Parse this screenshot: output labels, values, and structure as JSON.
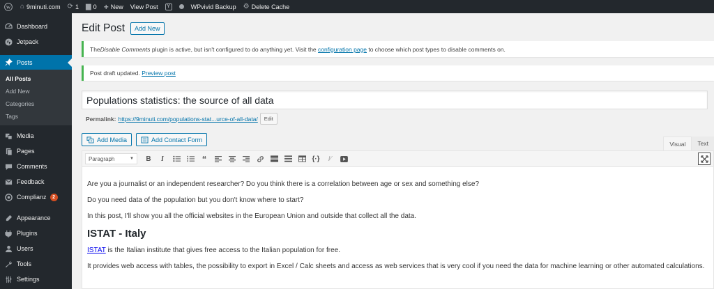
{
  "adminbar": {
    "site_name": "9minuti.com",
    "updates_count": "1",
    "comments_count": "0",
    "new_label": "New",
    "view_post_label": "View Post",
    "wpvivid_label": "WPvivid Backup",
    "delete_cache_label": "Delete Cache"
  },
  "sidebar": {
    "items": [
      {
        "label": "Dashboard",
        "icon": "dashboard-icon"
      },
      {
        "label": "Jetpack",
        "icon": "jetpack-icon"
      },
      {
        "label": "Posts",
        "icon": "pin-icon"
      },
      {
        "label": "Media",
        "icon": "media-icon"
      },
      {
        "label": "Pages",
        "icon": "pages-icon"
      },
      {
        "label": "Comments",
        "icon": "comments-icon"
      },
      {
        "label": "Feedback",
        "icon": "feedback-icon"
      },
      {
        "label": "Complianz",
        "icon": "complianz-icon",
        "badge": "2"
      },
      {
        "label": "Appearance",
        "icon": "appearance-icon"
      },
      {
        "label": "Plugins",
        "icon": "plugins-icon"
      },
      {
        "label": "Users",
        "icon": "users-icon"
      },
      {
        "label": "Tools",
        "icon": "tools-icon"
      },
      {
        "label": "Settings",
        "icon": "settings-icon"
      }
    ],
    "posts_submenu": [
      "All Posts",
      "Add New",
      "Categories",
      "Tags"
    ]
  },
  "main": {
    "page_title": "Edit Post",
    "add_new_label": "Add New",
    "notice1": {
      "before": "The ",
      "plugin": "Disable Comments",
      "middle": " plugin is active, but isn't configured to do anything yet. Visit the ",
      "link": "configuration page",
      "after": " to choose which post types to disable comments on."
    },
    "notice2": {
      "text": "Post draft updated. ",
      "link": "Preview post"
    },
    "post_title": "Populations statistics: the source of all data",
    "permalink_label": "Permalink:",
    "permalink_url": "https://9minuti.com/populations-stat...urce-of-all-data/",
    "edit_label": "Edit",
    "add_media_label": "Add Media",
    "add_contact_form_label": "Add Contact Form",
    "tab_visual": "Visual",
    "tab_text": "Text",
    "format_select": "Paragraph",
    "content": {
      "p1": "Are you a journalist or an independent researcher? Do you think there is a correlation between age or sex and something else?",
      "p2": "Do you need data of the population but you don't know where to start?",
      "p3": "In this post, I'll show you all the official websites in the European Union and outside that collect all the data.",
      "h1": "ISTAT - Italy",
      "p4_link": "ISTAT",
      "p4_rest": " is the Italian institute that gives free access to the Italian population for free.",
      "p5": "It provides web access with tables, the possibility to export in Excel / Calc sheets and access as web services that is very cool if you need the data for machine learning or other automated calculations."
    }
  },
  "colors": {
    "adminbar_bg": "#23282d",
    "sidebar_bg": "#23282d",
    "accent": "#0073aa",
    "notice_border": "#46b450",
    "badge": "#d54e21"
  }
}
